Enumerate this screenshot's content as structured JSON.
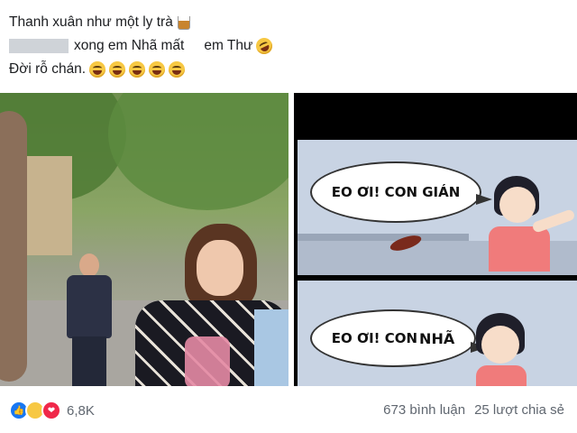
{
  "caption": {
    "line1": "Thanh xuân như một ly trà",
    "line1_emoji": "drink-glass",
    "line2_part1": "xong em Nhã mất",
    "line2_part2": "em Thư",
    "line2_emoji": "rofl",
    "line3": "Đời rỗ chán.",
    "line3_emoji_count": 5
  },
  "comic": {
    "panel1_text": "EO ƠI! CON GIÁN",
    "panel2_text_a": "EO ƠI! CON",
    "panel2_text_b": "NHÃ"
  },
  "reactions": {
    "icons": [
      "like",
      "haha",
      "love"
    ],
    "count": "6,8K"
  },
  "stats": {
    "comments": "673 bình luận",
    "shares": "25 lượt chia sẻ"
  }
}
